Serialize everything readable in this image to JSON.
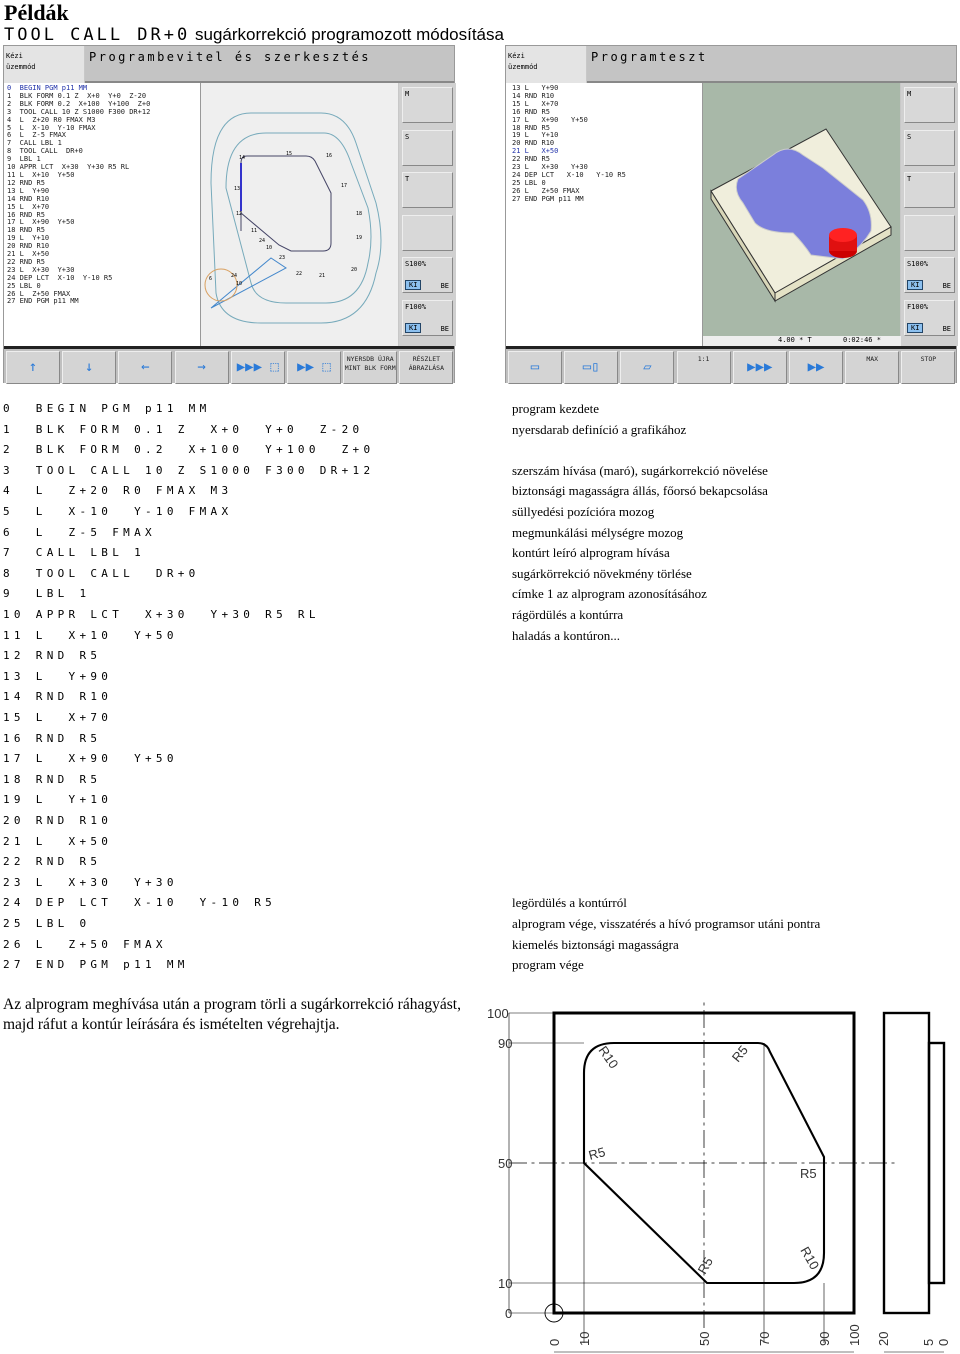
{
  "title": "Példák",
  "subtitle": {
    "code": "TOOL CALL",
    "code2": "DR+0",
    "text": "sugárkorrekció programozott módosítása"
  },
  "left_screen": {
    "mode": [
      "Kézi",
      "üzemmód"
    ],
    "title": "Programbevitel és szerkesztés",
    "listing": [
      "0  BEGIN PGM p11 MM",
      "1  BLK FORM 0.1 Z  X+0  Y+0  Z-20",
      "2  BLK FORM 0.2  X+100  Y+100  Z+0",
      "3  TOOL CALL 10 Z S1000 F300 DR+12",
      "4  L  Z+20 R0 FMAX M3",
      "5  L  X-10  Y-10 FMAX",
      "6  L  Z-5 FMAX",
      "7  CALL LBL 1",
      "8  TOOL CALL  DR+0",
      "9  LBL 1",
      "10 APPR LCT  X+30  Y+30 R5 RL",
      "11 L  X+10  Y+50",
      "12 RND R5",
      "13 L  Y+90",
      "14 RND R10",
      "15 L  X+70",
      "16 RND R5",
      "17 L  X+90  Y+50",
      "18 RND R5",
      "19 L  Y+10",
      "20 RND R10",
      "21 L  X+50",
      "22 RND R5",
      "23 L  X+30  Y+30",
      "24 DEP LCT  X-10  Y-10 R5",
      "25 LBL 0",
      "26 L  Z+50 FMAX",
      "27 END PGM p11 MM"
    ],
    "side_keys": [
      "M",
      "S",
      "T",
      "",
      "S100%",
      "F100%"
    ],
    "ki": "KI",
    "be": "BE",
    "bottom_keys": [
      "",
      "",
      "",
      "",
      "",
      "",
      "NYERSDB ÚJRA MINT BLK FORM",
      "RÉSZLET ÁBRAZLÁSA"
    ],
    "contour_labels": [
      "14",
      "15",
      "16",
      "13",
      "17",
      "12",
      "18",
      "11",
      "19",
      "24",
      "10",
      "23",
      "22",
      "21",
      "20",
      "6",
      "24",
      "10"
    ]
  },
  "right_screen": {
    "mode": [
      "Kézi",
      "üzemmód"
    ],
    "title": "Programteszt",
    "listing": [
      "13 L   Y+90",
      "14 RND R10",
      "15 L   X+70",
      "16 RND R5",
      "17 L   X+90   Y+50",
      "18 RND R5",
      "19 L   Y+10",
      "20 RND R10",
      "21 L   X+50",
      "22 RND R5",
      "23 L   X+30   Y+30",
      "24 DEP LCT   X-10   Y-10 R5",
      "25 LBL 0",
      "26 L   Z+50 FMAX",
      "27 END PGM p11 MM"
    ],
    "active_line": 8,
    "status": {
      "scale": "4.00 * T",
      "time": "0:02:46 *"
    },
    "bottom_keys": [
      "",
      "",
      "",
      "1:1",
      "",
      "",
      "MAX",
      "STOP"
    ],
    "colors": {
      "background": "#a8b8a8",
      "pocket": "#7b7fdc",
      "block": "#f0eedc",
      "tool": "#e01010"
    }
  },
  "program": [
    {
      "code": "0  BEGIN PGM p11 MM",
      "comment": "program kezdete"
    },
    {
      "code": "1  BLK FORM 0.1 Z  X+0  Y+0  Z-20",
      "comment": "nyersdarab definíció a grafikához"
    },
    {
      "code": "2  BLK FORM 0.2  X+100  Y+100  Z+0",
      "comment": ""
    },
    {
      "code": "3  TOOL CALL 10 Z S1000 F300 DR+12",
      "comment": "szerszám hívása (maró), sugárkorrekció növelése"
    },
    {
      "code": "4  L  Z+20 R0 FMAX M3",
      "comment": "biztonsági magasságra állás, főorsó bekapcsolása"
    },
    {
      "code": "5  L  X-10  Y-10 FMAX",
      "comment": "süllyedési pozícióra mozog"
    },
    {
      "code": "6  L  Z-5 FMAX",
      "comment": "megmunkálási mélységre mozog"
    },
    {
      "code": "7  CALL LBL 1",
      "comment": "kontúrt leíró alprogram hívása"
    },
    {
      "code": "8  TOOL CALL  DR+0",
      "comment": "sugárkörrekció növekmény törlése"
    },
    {
      "code": "9  LBL 1",
      "comment": "címke 1 az alprogram azonosításához"
    },
    {
      "code": "10 APPR LCT  X+30  Y+30 R5 RL",
      "comment": "rágördülés a kontúrra"
    },
    {
      "code": "11 L  X+10  Y+50",
      "comment": "haladás a kontúron..."
    },
    {
      "code": "12 RND R5",
      "comment": ""
    },
    {
      "code": "13 L  Y+90",
      "comment": ""
    },
    {
      "code": "14 RND R10",
      "comment": ""
    },
    {
      "code": "15 L  X+70",
      "comment": ""
    },
    {
      "code": "16 RND R5",
      "comment": ""
    },
    {
      "code": "17 L  X+90  Y+50",
      "comment": ""
    },
    {
      "code": "18 RND R5",
      "comment": ""
    },
    {
      "code": "19 L  Y+10",
      "comment": ""
    },
    {
      "code": "20 RND R10",
      "comment": ""
    },
    {
      "code": "21 L  X+50",
      "comment": ""
    },
    {
      "code": "22 RND R5",
      "comment": ""
    },
    {
      "code": "23 L  X+30  Y+30",
      "comment": ""
    },
    {
      "code": "24 DEP LCT  X-10  Y-10 R5",
      "comment": "legördülés a kontúrról"
    },
    {
      "code": "25 LBL 0",
      "comment": "alprogram vége, visszatérés a hívó programsor utáni pontra"
    },
    {
      "code": "26 L  Z+50 FMAX",
      "comment": "kiemelés biztonsági magasságra"
    },
    {
      "code": "27 END PGM p11 MM",
      "comment": "program vége"
    }
  ],
  "paragraph": "Az alprogram meghívása után a program törli a sugárkorrekció ráhagyást, majd ráfut a kontúr leírására és ismételten végrehajtja.",
  "drawing": {
    "y_labels": [
      "100",
      "90",
      "50",
      "10",
      "0"
    ],
    "x_labels": [
      "0",
      "10",
      "50",
      "70",
      "90",
      "100"
    ],
    "side_labels": [
      "20",
      "5",
      "0"
    ],
    "radius_labels": [
      "R10",
      "R5",
      "R5",
      "R5",
      "R5",
      "R10"
    ]
  }
}
